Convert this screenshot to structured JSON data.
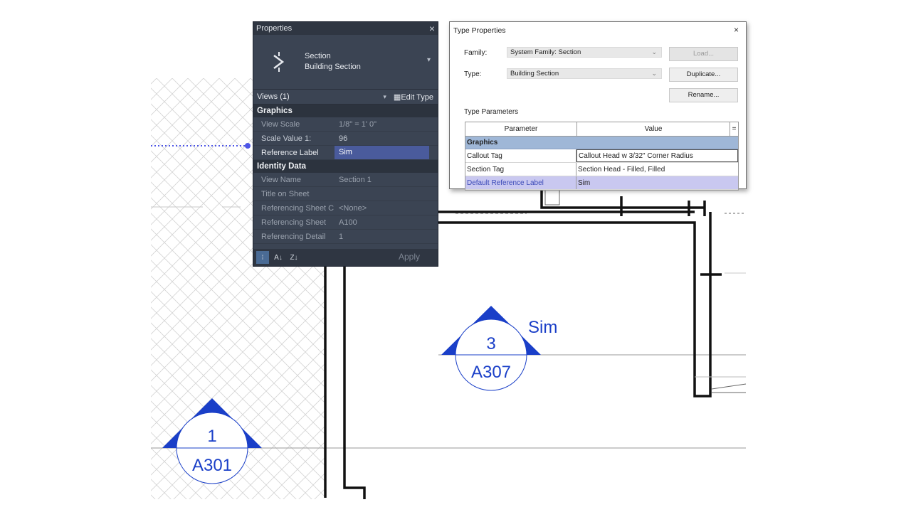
{
  "drawing": {
    "callouts": [
      {
        "number": "3",
        "sheet": "A307",
        "label": "Sim"
      },
      {
        "number": "1",
        "sheet": "A301",
        "label": ""
      }
    ],
    "tag_color": "#1a3fc8"
  },
  "properties": {
    "title": "Properties",
    "close_glyph": "×",
    "type_name": "Section",
    "type_subname": "Building Section",
    "views_selector": "Views (1)",
    "edit_type": "Edit Type",
    "groups": [
      {
        "name": "Graphics",
        "rows": [
          {
            "key": "View Scale",
            "value": "1/8\" = 1' 0\"",
            "state": "dim"
          },
          {
            "key": "Scale Value    1:",
            "value": "96",
            "state": "mid"
          },
          {
            "key": "Reference Label",
            "value": "Sim",
            "state": "active"
          }
        ]
      },
      {
        "name": "Identity Data",
        "rows": [
          {
            "key": "View Name",
            "value": "Section 1",
            "state": "dim"
          },
          {
            "key": "Title on Sheet",
            "value": "",
            "state": "dim"
          },
          {
            "key": "Referencing Sheet C...",
            "value": "<None>",
            "state": "dim"
          },
          {
            "key": "Referencing Sheet",
            "value": "A100",
            "state": "dim"
          },
          {
            "key": "Referencing Detail",
            "value": "1",
            "state": "dim"
          }
        ]
      }
    ],
    "apply": "Apply"
  },
  "type_properties": {
    "title": "Type Properties",
    "close_glyph": "×",
    "family_label": "Family:",
    "family_value": "System Family: Section",
    "type_label": "Type:",
    "type_value": "Building Section",
    "load": "Load...",
    "duplicate": "Duplicate...",
    "rename": "Rename...",
    "type_parameters": "Type Parameters",
    "col_parameter": "Parameter",
    "col_value": "Value",
    "col_extra": "=",
    "group": "Graphics",
    "rows": [
      {
        "parameter": "Callout Tag",
        "value": "Callout Head w 3/32\" Corner Radius"
      },
      {
        "parameter": "Section Tag",
        "value": "Section Head - Filled, Filled"
      },
      {
        "parameter": "Default Reference Label",
        "value": "Sim"
      }
    ]
  }
}
